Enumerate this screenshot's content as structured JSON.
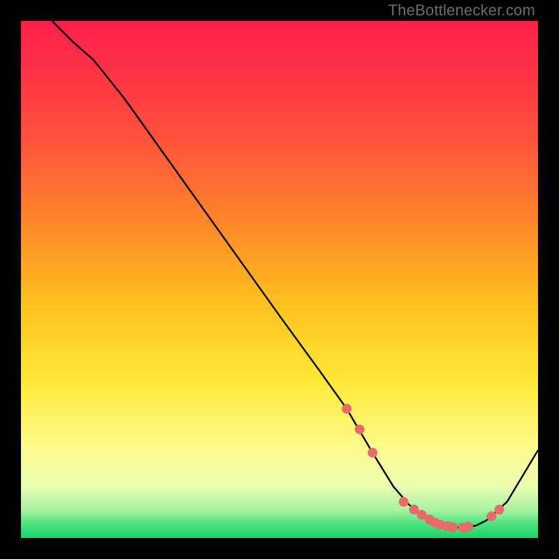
{
  "watermark": "TheBottlenecker.com",
  "colors": {
    "frame_bg": "#000000",
    "curve": "#000000",
    "marker_fill": "#e86a6a",
    "marker_stroke": "#c95555"
  },
  "chart_data": {
    "type": "line",
    "title": "",
    "xlabel": "",
    "ylabel": "",
    "xlim": [
      0,
      100
    ],
    "ylim": [
      0,
      100
    ],
    "gradient_stops": [
      {
        "offset": 0.0,
        "color": "#ff1f4b"
      },
      {
        "offset": 0.2,
        "color": "#ff4a3e"
      },
      {
        "offset": 0.4,
        "color": "#ff8a2a"
      },
      {
        "offset": 0.55,
        "color": "#ffc21e"
      },
      {
        "offset": 0.7,
        "color": "#ffe93a"
      },
      {
        "offset": 0.82,
        "color": "#fffb8a"
      },
      {
        "offset": 0.9,
        "color": "#ecfcb0"
      },
      {
        "offset": 0.945,
        "color": "#a9f3a3"
      },
      {
        "offset": 0.972,
        "color": "#4fe37e"
      },
      {
        "offset": 1.0,
        "color": "#17d36a"
      }
    ],
    "series": [
      {
        "name": "bottleneck-curve",
        "x": [
          6,
          10,
          14,
          20,
          30,
          40,
          50,
          58,
          63,
          68,
          72,
          75,
          78,
          80,
          82,
          85,
          88,
          90,
          94,
          100
        ],
        "y": [
          100,
          96,
          92.5,
          85,
          71,
          57,
          43,
          32,
          25,
          16.5,
          10,
          6.5,
          4,
          2.8,
          2.2,
          2,
          2.4,
          3.4,
          7,
          17
        ]
      }
    ],
    "markers": {
      "name": "highlighted-points",
      "x": [
        63.0,
        65.5,
        68.0,
        74.0,
        76.0,
        77.5,
        79.0,
        80.0,
        81.0,
        82.5,
        83.5,
        85.5,
        86.5,
        91.0,
        92.5
      ],
      "y": [
        25.0,
        21.0,
        16.5,
        7.0,
        5.5,
        4.5,
        3.6,
        3.0,
        2.6,
        2.3,
        2.1,
        2.0,
        2.2,
        4.2,
        5.5
      ],
      "r": 7
    }
  }
}
